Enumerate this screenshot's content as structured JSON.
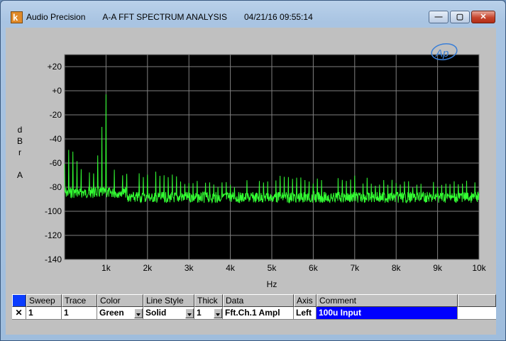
{
  "titlebar": {
    "app_name": "Audio Precision",
    "analysis": "A-A FFT SPECTRUM ANALYSIS",
    "timestamp": "04/21/16 09:55:14",
    "buttons": {
      "minimize": "—",
      "maximize": "▢",
      "close": "✕"
    }
  },
  "graph": {
    "logo": "Ap",
    "y_axis_label": [
      "d",
      "B",
      "r",
      "",
      "A"
    ],
    "x_axis_label": "Hz",
    "y_ticks": [
      "+20",
      "+0",
      "-20",
      "-40",
      "-60",
      "-80",
      "-100",
      "-120",
      "-140"
    ],
    "x_ticks": [
      "1k",
      "2k",
      "3k",
      "4k",
      "5k",
      "6k",
      "7k",
      "8k",
      "9k",
      "10k"
    ],
    "trace_color": "#33ff33",
    "background_color": "#000000"
  },
  "chart_data": {
    "type": "line",
    "title": "A-A FFT SPECTRUM ANALYSIS",
    "xlabel": "Hz",
    "ylabel": "dBr A",
    "xlim": [
      0,
      10000
    ],
    "ylim": [
      -140,
      30
    ],
    "grid": true,
    "series": [
      {
        "x": [
          0,
          50,
          100,
          150,
          250,
          500,
          750,
          1000,
          1100,
          1500,
          2000,
          2500,
          3000,
          3500,
          4000,
          4500,
          5000,
          5500,
          6000,
          6500,
          7000,
          7500,
          8000,
          8500,
          9000,
          9500,
          10000
        ],
        "y": [
          -60,
          -30,
          -45,
          -38,
          -55,
          -65,
          -66,
          -3,
          -62,
          -65,
          -66,
          -68,
          -74,
          -76,
          -75,
          -74,
          -70,
          -70,
          -73,
          -72,
          -70,
          -73,
          -74,
          -75,
          -75,
          -74,
          -73
        ]
      }
    ],
    "noise_floor": [
      -95,
      -80
    ]
  },
  "table": {
    "headers": [
      "Sweep",
      "Trace",
      "Color",
      "Line Style",
      "Thick",
      "Data",
      "Axis",
      "Comment"
    ],
    "row": {
      "enabled_mark": "✕",
      "sweep": "1",
      "trace": "1",
      "color": "Green",
      "line_style": "Solid",
      "thick": "1",
      "data": "Fft.Ch.1 Ampl",
      "axis": "Left",
      "comment": "100u Input"
    },
    "header_swatch_color": "#0a3cff"
  }
}
